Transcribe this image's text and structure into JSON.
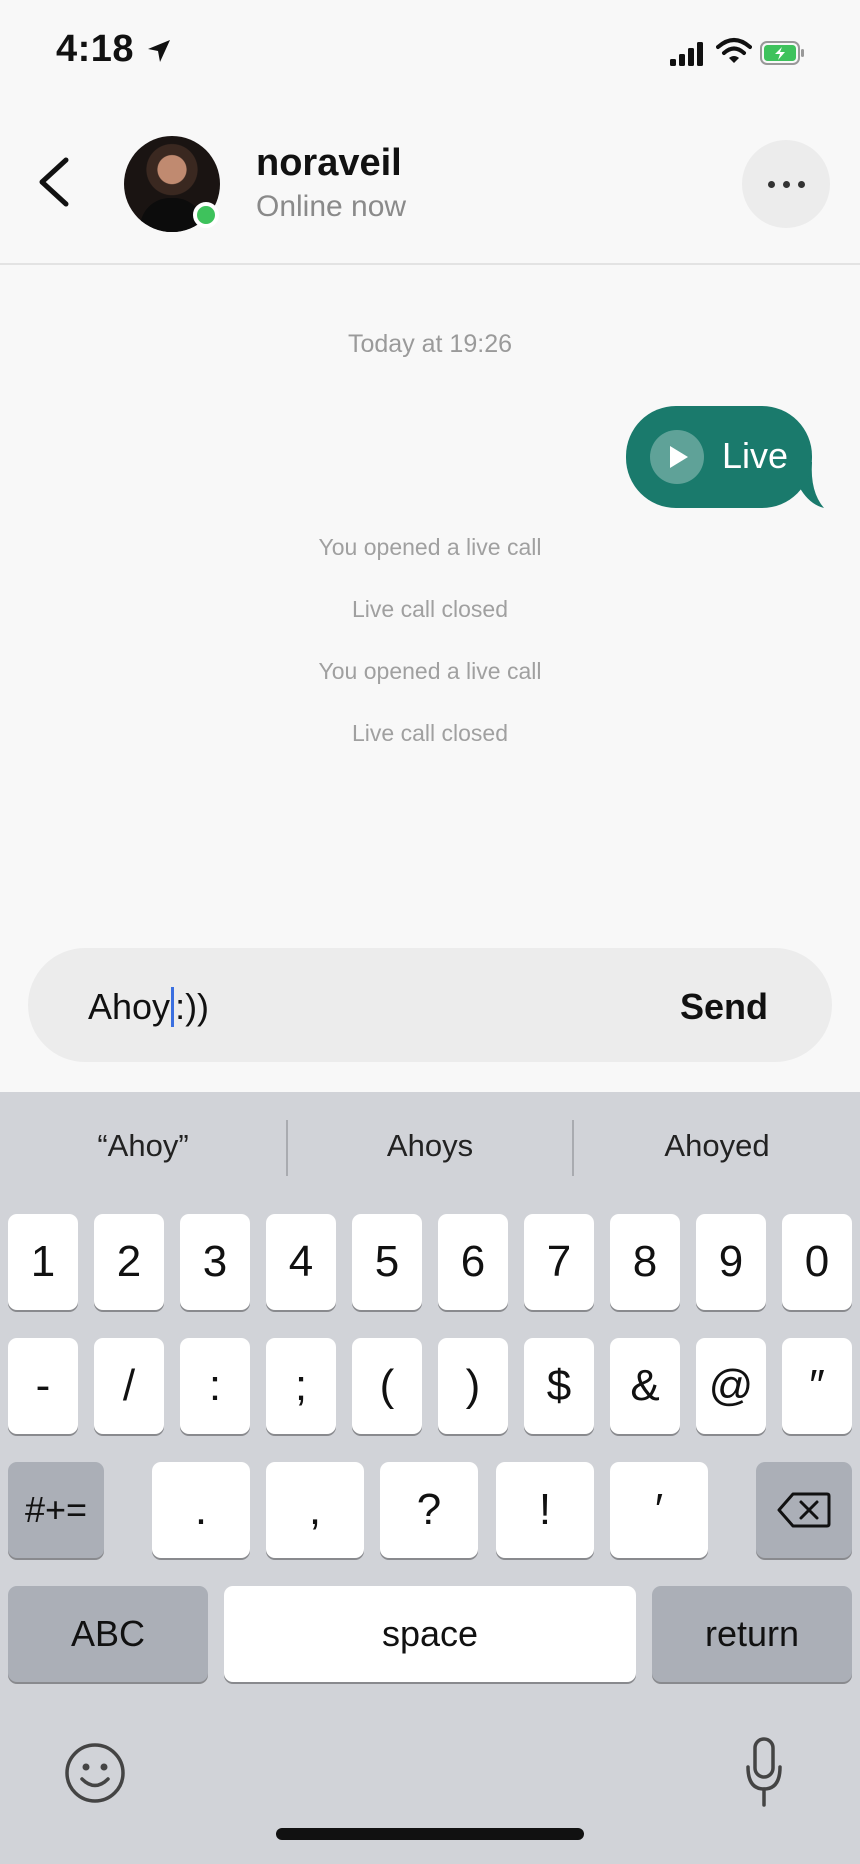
{
  "status_bar": {
    "time": "4:18"
  },
  "header": {
    "contact_name": "noraveil",
    "contact_status": "Online now"
  },
  "conversation": {
    "timestamp": "Today at 19:26",
    "bubble_label": "Live",
    "system_messages": [
      "You opened a live call",
      "Live call closed",
      "You opened a live call",
      "Live call closed"
    ]
  },
  "composer": {
    "text_before_cursor": "Ahoy",
    "text_after_cursor": ":))",
    "send_label": "Send"
  },
  "keyboard": {
    "suggestions": [
      "“Ahoy”",
      "Ahoys",
      "Ahoyed"
    ],
    "row1": [
      "1",
      "2",
      "3",
      "4",
      "5",
      "6",
      "7",
      "8",
      "9",
      "0"
    ],
    "row2": [
      "-",
      "/",
      ":",
      ";",
      "(",
      ")",
      "$",
      "&",
      "@",
      "″"
    ],
    "row3_mode": "#+=",
    "row3": [
      ".",
      ",",
      "?",
      "!",
      "′"
    ],
    "abc_label": "ABC",
    "space_label": "space",
    "return_label": "return"
  },
  "colors": {
    "accent": "#1a7a6c",
    "online": "#3ec25c",
    "caret": "#3a6fe0"
  }
}
